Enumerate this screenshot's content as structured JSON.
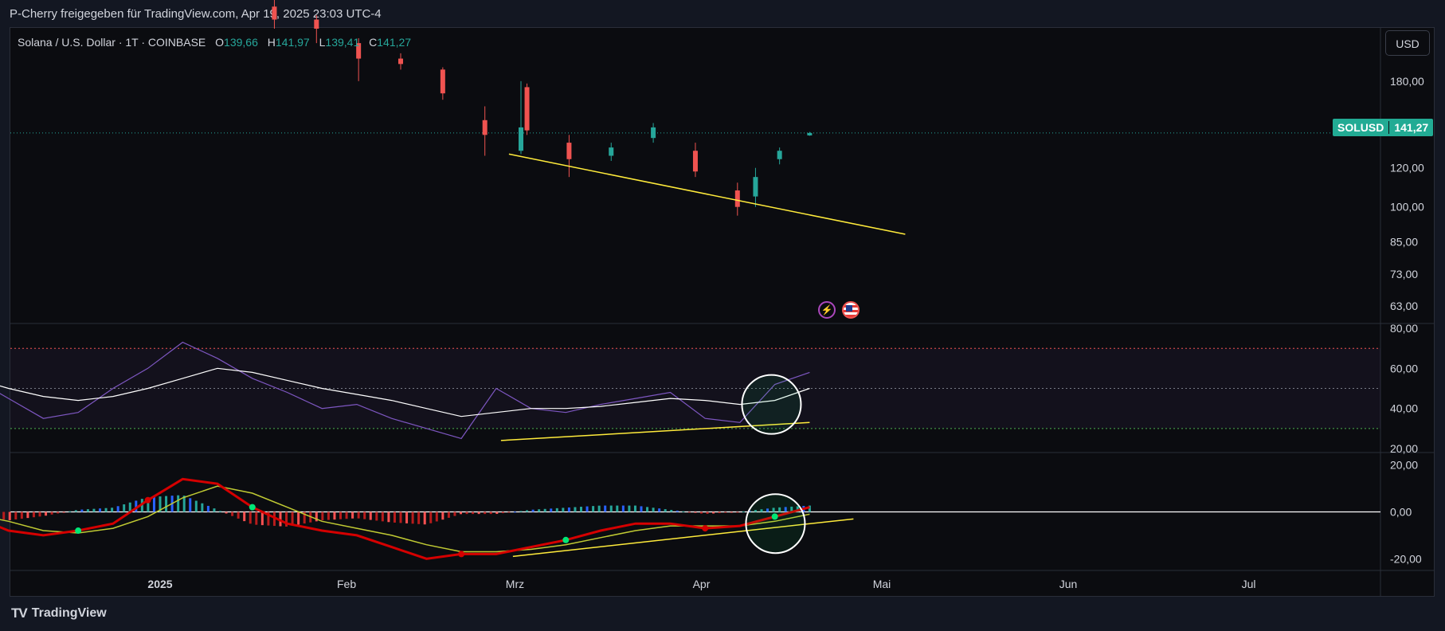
{
  "header": {
    "publisher_line": "P-Cherry freigegeben für TradingView.com, Apr 19, 2025 23:03 UTC-4"
  },
  "legend": {
    "symbol": "Solana / U.S. Dollar · 1T · COINBASE",
    "open_label": "O",
    "open": "139,66",
    "high_label": "H",
    "high": "141,97",
    "low_label": "L",
    "low": "139,41",
    "close_label": "C",
    "close": "141,27"
  },
  "currency_button": "USD",
  "price_label": {
    "symbol": "SOLUSD",
    "value": "141,27"
  },
  "footer": {
    "brand": "TradingView",
    "logo": "TV"
  },
  "icons": [
    "flash-event-icon",
    "us-flag-event-icon"
  ],
  "colors": {
    "up": "#26a69a",
    "down": "#ef5350",
    "trendline": "#ffeb3b",
    "rsi": "#7e57c2",
    "rsi_ma": "#ffffff",
    "macd_green": "#00e676",
    "macd_red": "#d50000"
  },
  "chart_data": [
    {
      "type": "candlestick",
      "title": "Solana / U.S. Dollar · 1T · COINBASE",
      "x_ticks": [
        "2025",
        "Feb",
        "Mrz",
        "Apr",
        "Mai",
        "Jun",
        "Jul"
      ],
      "y_ticks": [
        "180,00",
        "120,00",
        "100,00",
        "85,00",
        "73,00",
        "63,00"
      ],
      "y_scale": "log",
      "ylim": [
        58,
        230
      ],
      "last_price": 141.27,
      "series": [
        {
          "name": "SOLUSD",
          "ohlc_approx": [
            [
              "2025-01-20",
              255,
              265,
              230,
              240
            ],
            [
              "2025-01-27",
              240,
              245,
              215,
              230
            ],
            [
              "2025-02-03",
              215,
              220,
              180,
              200
            ],
            [
              "2025-02-10",
              200,
              205,
              190,
              195
            ],
            [
              "2025-02-17",
              190,
              192,
              165,
              170
            ],
            [
              "2025-02-24",
              150,
              160,
              127,
              140
            ],
            [
              "2025-03-02",
              130,
              180,
              128,
              145
            ],
            [
              "2025-03-03",
              175,
              178,
              140,
              143
            ],
            [
              "2025-03-10",
              135,
              140,
              115,
              125
            ],
            [
              "2025-03-17",
              127,
              135,
              124,
              132
            ],
            [
              "2025-03-24",
              138,
              148,
              135,
              145
            ],
            [
              "2025-03-31",
              130,
              135,
              115,
              118
            ],
            [
              "2025-04-07",
              108,
              112,
              96,
              100
            ],
            [
              "2025-04-10",
              105,
              120,
              100,
              115
            ],
            [
              "2025-04-14",
              125,
              132,
              122,
              130
            ],
            [
              "2025-04-19",
              139.66,
              141.97,
              139.41,
              141.27
            ]
          ]
        }
      ]
    },
    {
      "type": "line",
      "title": "RSI",
      "y_ticks": [
        "80,00",
        "60,00",
        "40,00",
        "20,00"
      ],
      "ylim": [
        18,
        82
      ],
      "levels": [
        70,
        50,
        30
      ],
      "series": [
        {
          "name": "RSI",
          "values": [
            55,
            45,
            35,
            38,
            50,
            60,
            73,
            65,
            55,
            48,
            40,
            42,
            35,
            30,
            25,
            50,
            40,
            38,
            42,
            45,
            48,
            35,
            33,
            52,
            58
          ]
        },
        {
          "name": "RSI MA",
          "values": [
            55,
            50,
            46,
            44,
            46,
            50,
            55,
            60,
            58,
            54,
            50,
            47,
            44,
            40,
            36,
            38,
            40,
            40,
            41,
            43,
            45,
            44,
            42,
            44,
            50
          ]
        }
      ]
    },
    {
      "type": "line",
      "title": "MACD",
      "y_ticks": [
        "20,00",
        "0,00",
        "-20,00"
      ],
      "ylim": [
        -25,
        25
      ],
      "series": [
        {
          "name": "MACD",
          "values": [
            -2,
            -8,
            -10,
            -8,
            -5,
            5,
            14,
            12,
            2,
            -5,
            -8,
            -10,
            -15,
            -20,
            -18,
            -18,
            -15,
            -12,
            -8,
            -5,
            -5,
            -7,
            -6,
            -2,
            2
          ]
        },
        {
          "name": "Signal",
          "values": [
            -1,
            -4,
            -8,
            -9,
            -7,
            -2,
            6,
            11,
            8,
            2,
            -4,
            -7,
            -10,
            -14,
            -17,
            -17,
            -16,
            -14,
            -11,
            -8,
            -6,
            -6,
            -6,
            -4,
            -1
          ]
        }
      ]
    }
  ]
}
